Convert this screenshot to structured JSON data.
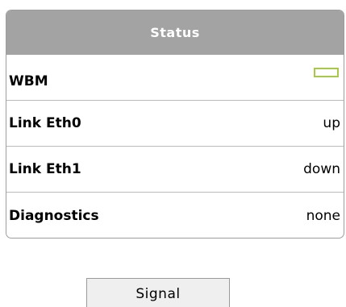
{
  "status_panel": {
    "title": "Status",
    "rows": [
      {
        "label": "WBM",
        "value": "",
        "indicator": "status-box-icon",
        "indicator_color": "#a8c84a"
      },
      {
        "label": "Link Eth0",
        "value": "up"
      },
      {
        "label": "Link Eth1",
        "value": "down"
      },
      {
        "label": "Diagnostics",
        "value": "none"
      }
    ]
  },
  "signal_button": {
    "label": "Signal"
  }
}
